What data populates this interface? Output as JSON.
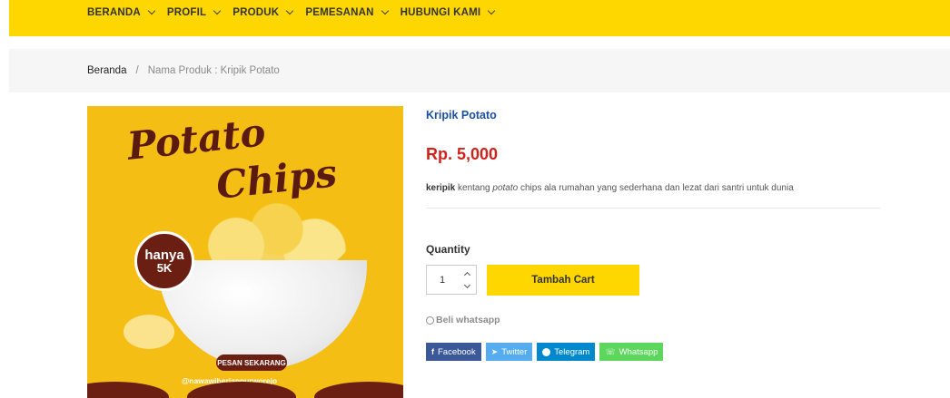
{
  "nav": {
    "items": [
      {
        "label": "BERANDA"
      },
      {
        "label": "PROFIL"
      },
      {
        "label": "PRODUK"
      },
      {
        "label": "PEMESANAN"
      },
      {
        "label": "HUBUNGI KAMI"
      }
    ]
  },
  "breadcrumb": {
    "home": "Beranda",
    "separator": "/",
    "current": "Nama Produk : Kripik Potato"
  },
  "product_image": {
    "title_line1": "Potato",
    "title_line2": "Chips",
    "badge_line1": "hanya",
    "badge_line2": "5K",
    "button": "PESAN SEKARANG",
    "handle": "@nawawiberjanpurworejo"
  },
  "product": {
    "name": "Kripik Potato",
    "price": "Rp. 5,000",
    "desc_bold": "keripik",
    "desc_mid": " kentang ",
    "desc_italic": "potato",
    "desc_rest": " chips ala rumahan yang sederhana dan lezat dari santri untuk dunia"
  },
  "cart": {
    "quantity_label": "Quantity",
    "quantity_value": "1",
    "add_button": "Tambah Cart"
  },
  "whatsapp_link": "Beli whatsapp",
  "share": {
    "facebook": "Facebook",
    "twitter": "Twitter",
    "telegram": "Telegram",
    "whatsapp": "Whatsapp"
  },
  "colors": {
    "brand_yellow": "#FFD700",
    "price_red": "#d0211a",
    "link_blue": "#1a4fa0",
    "image_bg": "#F5BE14",
    "image_brown": "#6B1E12"
  }
}
